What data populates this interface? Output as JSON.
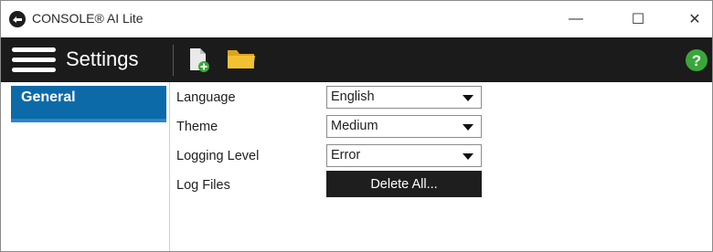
{
  "window": {
    "title": "CONSOLE® AI Lite",
    "controls": {
      "minimize": "—",
      "maximize": "☐",
      "close": "✕"
    },
    "icon": "app-logo-icon"
  },
  "toolbar": {
    "menu_icon": "hamburger-menu-icon",
    "title": "Settings",
    "actions": [
      {
        "icon": "new-file-icon"
      },
      {
        "icon": "folder-icon"
      }
    ],
    "help_icon": "help-icon",
    "colors": {
      "background": "#1b1b1b",
      "help": "#3aa63a",
      "folder": "#f2c233"
    }
  },
  "sidebar": {
    "items": [
      {
        "label": "General",
        "selected": true
      }
    ],
    "colors": {
      "selected_bg": "#0d6aa8",
      "selected_underline": "#2a86d0"
    }
  },
  "settings": {
    "language": {
      "label": "Language",
      "value": "English"
    },
    "theme": {
      "label": "Theme",
      "value": "Medium"
    },
    "logging_level": {
      "label": "Logging Level",
      "value": "Error"
    },
    "log_files": {
      "label": "Log Files",
      "button": "Delete All..."
    }
  }
}
